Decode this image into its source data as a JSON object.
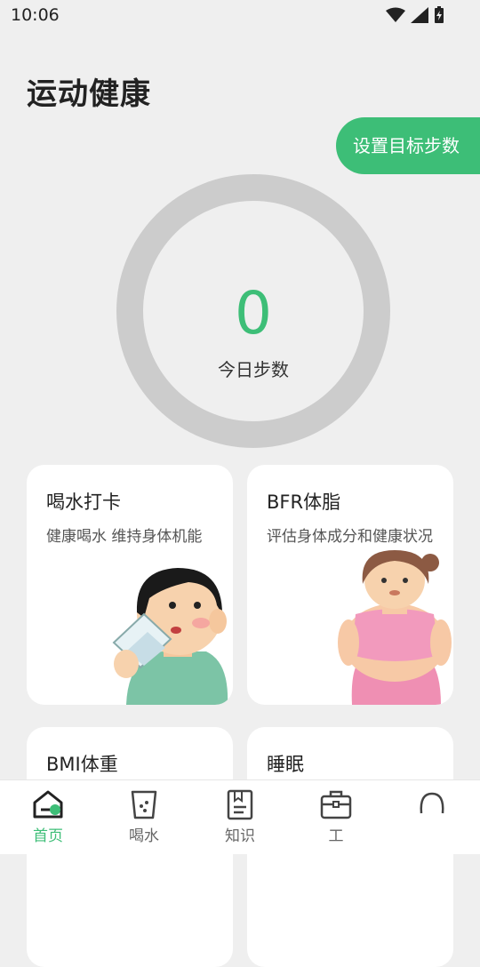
{
  "status": {
    "time": "10:06"
  },
  "page": {
    "title": "运动健康"
  },
  "goal_button": {
    "label": "设置目标步数"
  },
  "steps": {
    "count": "0",
    "label": "今日步数"
  },
  "cards": [
    {
      "title": "喝水打卡",
      "subtitle": "健康喝水 维持身体机能"
    },
    {
      "title": "BFR体脂",
      "subtitle": "评估身体成分和健康状况"
    },
    {
      "title": "BMI体重",
      "subtitle": ""
    },
    {
      "title": "睡眠",
      "subtitle": ""
    }
  ],
  "nav": {
    "items": [
      {
        "label": "首页",
        "icon": "home-icon",
        "active": true
      },
      {
        "label": "喝水",
        "icon": "cup-icon",
        "active": false
      },
      {
        "label": "知识",
        "icon": "book-icon",
        "active": false
      },
      {
        "label": "工",
        "icon": "briefcase-icon",
        "active": false
      },
      {
        "label": "",
        "icon": "profile-icon",
        "active": false
      }
    ]
  },
  "colors": {
    "accent": "#3dbe77",
    "ring": "#cccccc",
    "background": "#efefef"
  }
}
